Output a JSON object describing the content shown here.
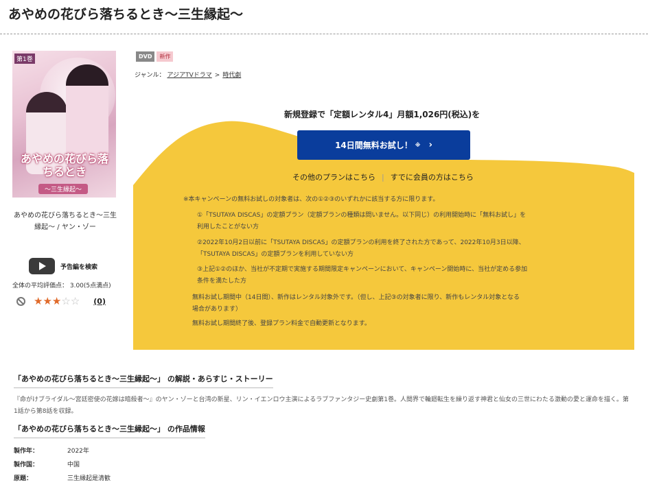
{
  "page": {
    "title": "あやめの花びら落ちるとき〜三生縁起〜"
  },
  "jacket": {
    "vol": "第1巻",
    "title": "あやめの花びら落ちるとき",
    "subtitle": "〜三生縁起〜"
  },
  "left": {
    "caption_line1": "あやめの花びら落ちるとき〜三生",
    "caption_line2": "縁起〜 / ヤン・ゾー",
    "trailer_label": "予告編を検索",
    "avg_rating": "全体の平均評価点： 3.00(5点満点)",
    "star_rating": 3,
    "star_max": 5,
    "review_count": "(0)"
  },
  "badges": {
    "dvd": "DVD",
    "new": "新作"
  },
  "genre": {
    "label": "ジャンル：",
    "item1": "アジアTVドラマ",
    "sep": ">",
    "item2": "時代劇"
  },
  "campaign": {
    "headline": "新規登録で「定額レンタル4」月額1,026円(税込)を",
    "button_label": "14日間無料お試し！",
    "button_note": "※",
    "chevron": "›",
    "other_plans": "その他のプランはこちら",
    "divider": "|",
    "members": "すでに会員の方はこちら",
    "bg_color": "#f5c83c",
    "button_color": "#0a3d9c",
    "notes": {
      "intro": "※本キャンペーンの無料お試しの対象者は、次の①②③のいずれかに該当する方に限ります。",
      "n1a": "①「TSUTAYA DISCAS」の定額プラン（定額プランの種類は問いません。以下同じ）の利用開始時に「無料お試し」を",
      "n1b": "利用したことがない方",
      "n2a": "②2022年10月2日以前に「TSUTAYA DISCAS」の定額プランの利用を終了された方であって、2022年10月3日以降、",
      "n2b": "「TSUTAYA DISCAS」の定額プランを利用していない方",
      "n3a": "③上記①②のほか、当社が不定期で実施する期間限定キャンペーンにおいて、キャンペーン開始時に、当社が定める参加",
      "n3b": "条件を満たした方",
      "p1a": "無料お試し期間中（14日間）、新作はレンタル対象外です。（但し、上記③の対象者に限り、新作もレンタル対象となる",
      "p1b": "場合があります）",
      "p2": "無料お試し期間終了後、登録プラン料金で自動更新となります。"
    }
  },
  "story": {
    "heading": "「あやめの花びら落ちるとき〜三生縁起〜」 の解説・あらすじ・ストーリー",
    "text": "『命がけブライダル〜宮廷密使の花嫁は暗殺者〜』のヤン・ゾーと台湾の新星、リン・イエンロウ主演によるラブファンタジー史劇第1巻。人間界で輪廻転生を繰り返す神君と仙女の三世にわたる激動の愛と運命を描く。第1話から第8話を収録。"
  },
  "info": {
    "heading": "「あやめの花びら落ちるとき〜三生縁起〜」 の作品情報",
    "rows": [
      {
        "k": "製作年：",
        "v": "2022年"
      },
      {
        "k": "製作国：",
        "v": "中国"
      },
      {
        "k": "原題：",
        "v": "三生縁起是清歓"
      }
    ]
  }
}
